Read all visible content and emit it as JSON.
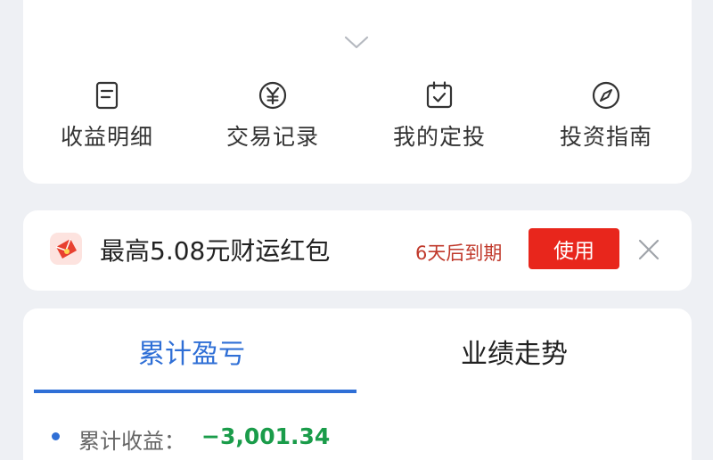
{
  "menu": {
    "items": [
      {
        "label": "收益明细",
        "icon": "document-icon"
      },
      {
        "label": "交易记录",
        "icon": "yuan-circle-icon"
      },
      {
        "label": "我的定投",
        "icon": "calendar-check-icon"
      },
      {
        "label": "投资指南",
        "icon": "compass-icon"
      }
    ]
  },
  "promo": {
    "title": "最高5.08元财运红包",
    "expire": "6天后到期",
    "use_label": "使用",
    "icon": "red-packet-icon"
  },
  "tabs": {
    "cumulative": "累计盈亏",
    "trend": "业绩走势"
  },
  "stats": {
    "label": "累计收益：",
    "value": "−3,001.34"
  },
  "colors": {
    "accent": "#2f6fd6",
    "promo_red": "#e8261c",
    "expire_red": "#c0392b",
    "negative_green": "#1a9c4a",
    "background": "#eef0f4"
  }
}
